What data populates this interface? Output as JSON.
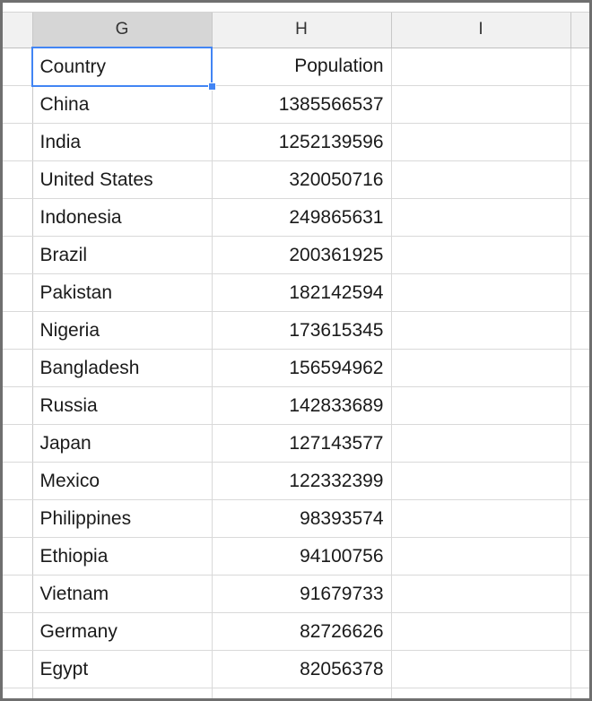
{
  "spreadsheet": {
    "columns": [
      {
        "letter": "G",
        "active": true
      },
      {
        "letter": "H",
        "active": false
      },
      {
        "letter": "I",
        "active": false
      }
    ],
    "active_cell": {
      "reference": "G1",
      "column": "G",
      "value": "Country"
    },
    "colors": {
      "selection": "#4285f4",
      "fill_handle": "#4285f4",
      "header_background": "#f1f1f1",
      "header_active_background": "#d6d6d6",
      "gridline": "#d9d9d9",
      "cell_text": "#1a1a1a",
      "frame": "#6f6f6f"
    },
    "headers": {
      "country": "Country",
      "population": "Population"
    },
    "rows": [
      {
        "country": "Country",
        "population": "Population"
      },
      {
        "country": "China",
        "population": "1385566537"
      },
      {
        "country": "India",
        "population": "1252139596"
      },
      {
        "country": "United States",
        "population": "320050716"
      },
      {
        "country": "Indonesia",
        "population": "249865631"
      },
      {
        "country": "Brazil",
        "population": "200361925"
      },
      {
        "country": "Pakistan",
        "population": "182142594"
      },
      {
        "country": "Nigeria",
        "population": "173615345"
      },
      {
        "country": "Bangladesh",
        "population": "156594962"
      },
      {
        "country": "Russia",
        "population": "142833689"
      },
      {
        "country": "Japan",
        "population": "127143577"
      },
      {
        "country": "Mexico",
        "population": "122332399"
      },
      {
        "country": "Philippines",
        "population": "98393574"
      },
      {
        "country": "Ethiopia",
        "population": "94100756"
      },
      {
        "country": "Vietnam",
        "population": "91679733"
      },
      {
        "country": "Germany",
        "population": "82726626"
      },
      {
        "country": "Egypt",
        "population": "82056378"
      }
    ]
  }
}
